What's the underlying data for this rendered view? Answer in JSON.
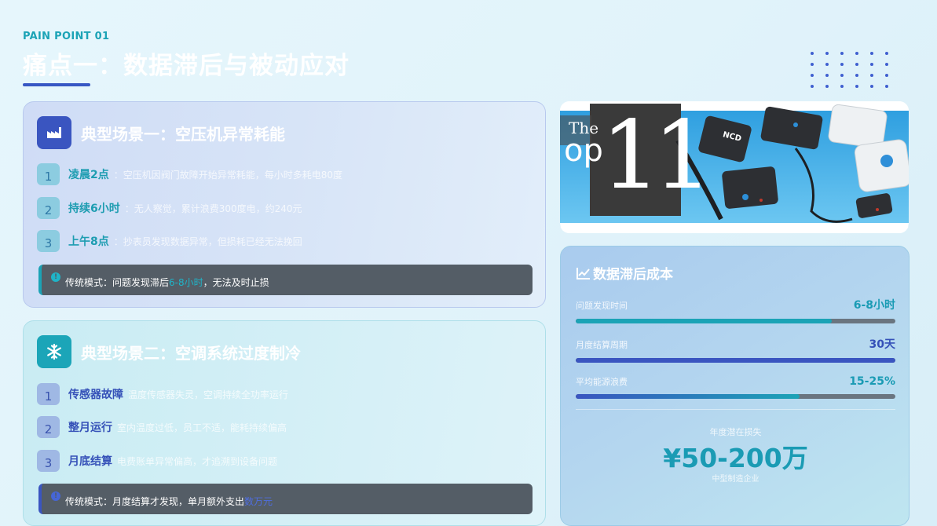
{
  "header": {
    "eyebrow": "PAIN POINT 01",
    "title": "痛点一：数据滞后与被动应对"
  },
  "scenario1": {
    "title": "典型场景一：空压机异常耗能",
    "icon": "factory-icon",
    "steps": [
      {
        "num": "1",
        "label": "凌晨2点",
        "desc": "：空压机因阀门故障开始异常耗能，每小时多耗电80度"
      },
      {
        "num": "2",
        "label": "持续6小时",
        "desc": "：无人察觉，累计浪费300度电，约240元"
      },
      {
        "num": "3",
        "label": "上午8点",
        "desc": "：抄表员发现数据异常，但损耗已经无法挽回"
      }
    ],
    "banner": {
      "prefix": "传统模式：问题发现滞后",
      "highlight": "6-8小时",
      "suffix": "，无法及时止损"
    }
  },
  "scenario2": {
    "title": "典型场景二：空调系统过度制冷",
    "icon": "snowflake-icon",
    "steps": [
      {
        "num": "1",
        "label": "传感器故障",
        "desc": "温度传感器失灵，空调持续全功率运行"
      },
      {
        "num": "2",
        "label": "整月运行",
        "desc": "室内温度过低，员工不适，能耗持续偏高"
      },
      {
        "num": "3",
        "label": "月底结算",
        "desc": "电费账单异常偏高，才追溯到设备问题"
      }
    ],
    "banner": {
      "prefix": "传统模式：月度结算才发现，单月额外支出",
      "highlight": "数万元",
      "suffix": ""
    }
  },
  "photo": {
    "badge_top": "The",
    "badge_mid": "op",
    "badge_num": "11",
    "brand": "NCD"
  },
  "cost": {
    "title": "数据滞后成本",
    "icon": "line-chart-icon",
    "metrics": [
      {
        "label": "问题发现时间",
        "value": "6-8小时",
        "fill": 0.8,
        "value_color": "#1a9bb4",
        "bar": "#1ba3b6"
      },
      {
        "label": "月度结算周期",
        "value": "30天",
        "fill": 1.0,
        "value_color": "#3551b8",
        "bar": "#3a55c0"
      },
      {
        "label": "平均能源浪费",
        "value": "15-25%",
        "fill": 0.7,
        "value_color": "#1a9bb4",
        "bar": "gradient"
      }
    ],
    "loss_label": "年度潜在损失",
    "loss_value": "¥50-200万",
    "loss_sub": "中型制造企业"
  }
}
